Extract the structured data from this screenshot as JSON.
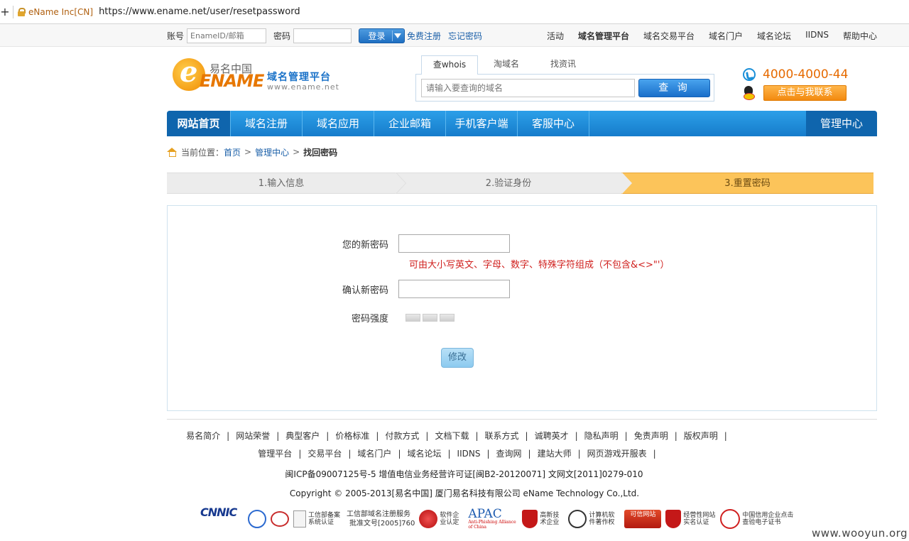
{
  "browser": {
    "cert_label": "eName Inc[CN]",
    "url": "https://www.ename.net/user/resetpassword",
    "new_tab_glyph": "+"
  },
  "topbar": {
    "account_label": "账号",
    "account_placeholder": "EnameID/邮箱",
    "password_label": "密码",
    "login_label": "登录",
    "register_link": "免费注册",
    "forgot_link": "忘记密码",
    "nav": [
      "活动",
      "域名管理平台",
      "域名交易平台",
      "域名门户",
      "域名论坛",
      "IIDNS",
      "帮助中心"
    ]
  },
  "logo": {
    "cn_name": "易名中国",
    "brand": "ENAME",
    "platform": "域名管理平台",
    "site": "www.ename.net"
  },
  "search": {
    "tabs": [
      "查whois",
      "淘域名",
      "找资讯"
    ],
    "active_tab": "查whois",
    "placeholder": "请输入要查询的域名",
    "button_label": "查 询"
  },
  "contact": {
    "hotline": "4000-4000-44",
    "qq_button": "点击与我联系"
  },
  "mainnav": {
    "items": [
      "网站首页",
      "域名注册",
      "域名应用",
      "企业邮箱",
      "手机客户端",
      "客服中心"
    ],
    "right": "管理中心"
  },
  "breadcrumb": {
    "prefix": "当前位置：",
    "items": [
      "首页",
      "管理中心"
    ],
    "current": "找回密码",
    "separator": ">"
  },
  "steps": {
    "items": [
      "1.输入信息",
      "2.验证身份",
      "3.重置密码"
    ],
    "active_index": 2
  },
  "form": {
    "new_password_label": "您的新密码",
    "hint": "可由大小写英文、字母、数字、特殊字符组成（不包含&<>\"'）",
    "confirm_label": "确认新密码",
    "strength_label": "密码强度",
    "submit_label": "修改"
  },
  "footer": {
    "links_row1": [
      "易名简介",
      "网站荣誉",
      "典型客户",
      "价格标准",
      "付款方式",
      "文档下载",
      "联系方式",
      "诚聘英才",
      "隐私声明",
      "免责声明",
      "版权声明"
    ],
    "links_row2": [
      "管理平台",
      "交易平台",
      "域名门户",
      "域名论坛",
      "IIDNS",
      "查询网",
      "建站大师",
      "网页游戏开服表"
    ],
    "icp": "闽ICP备09007125号-5 增值电信业务经营许可证[闽B2-20120071] 文网文[2011]0279-010",
    "copyright": "Copyright © 2005-2013[易名中国] 厦门易名科技有限公司 eName Technology Co.,Ltd.",
    "badges": {
      "cnnic": "CNNIC",
      "miit_record": "工信部备案系统认证",
      "miit_registrar": "工信部域名注册服务",
      "miit_approval": "批准文号[2005]760",
      "software": "软件企业认定",
      "apac": "APAC",
      "apac_sub": "Anti-Phishing Alliance of China",
      "hitech": "高新技术企业",
      "copyright_reg": "计算机软件著作权",
      "trusted_site": "可信网站",
      "realname": "经营性网站实名认证",
      "credit": "中国信用企业点击查验电子证书"
    }
  },
  "watermark": "www.wooyun.org"
}
